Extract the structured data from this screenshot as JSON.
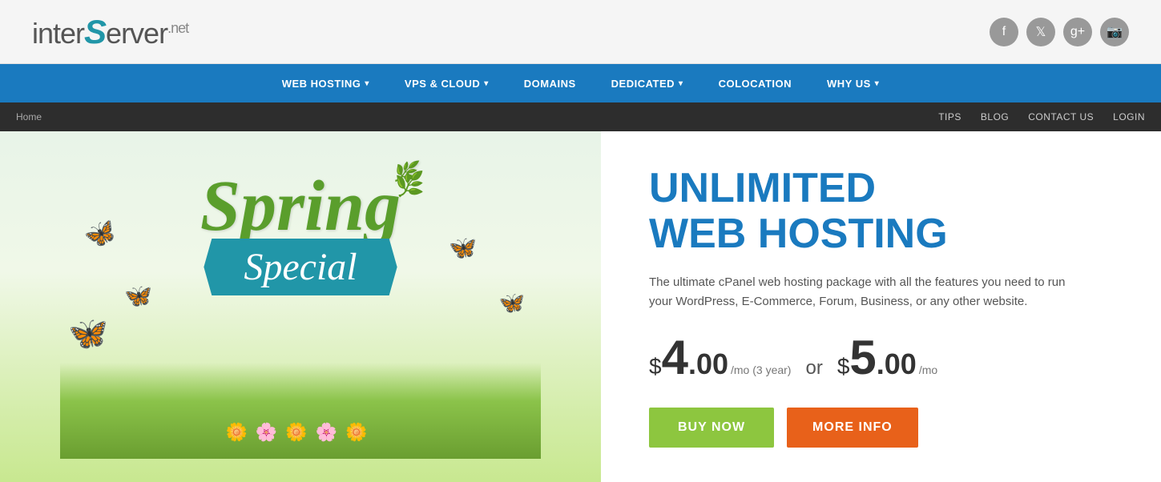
{
  "header": {
    "logo": {
      "part1": "inter",
      "curl": "S",
      "part2": "erver",
      "tld": ".net"
    },
    "social": [
      {
        "name": "facebook",
        "icon": "f"
      },
      {
        "name": "twitter",
        "icon": "t"
      },
      {
        "name": "google-plus",
        "icon": "g+"
      },
      {
        "name": "instagram",
        "icon": "in"
      }
    ]
  },
  "nav": {
    "items": [
      {
        "label": "WEB HOSTING",
        "has_dropdown": true
      },
      {
        "label": "VPS & CLOUD",
        "has_dropdown": true
      },
      {
        "label": "DOMAINS",
        "has_dropdown": false
      },
      {
        "label": "DEDICATED",
        "has_dropdown": true
      },
      {
        "label": "COLOCATION",
        "has_dropdown": false
      },
      {
        "label": "WHY US",
        "has_dropdown": true
      }
    ]
  },
  "secondary_nav": {
    "breadcrumb": "Home",
    "links": [
      {
        "label": "TIPS"
      },
      {
        "label": "BLOG"
      },
      {
        "label": "CONTACT US"
      },
      {
        "label": "LOGIN"
      }
    ]
  },
  "banner": {
    "spring_text": "Spring",
    "special_text": "Special",
    "leaf_emoji": "🌿",
    "butterflies": [
      "🦋",
      "🦋",
      "🦋",
      "🦋",
      "🦋"
    ]
  },
  "offer": {
    "headline_line1": "UNLIMITED",
    "headline_line2": "WEB HOSTING",
    "description": "The ultimate cPanel web hosting package with all the features you need to run your WordPress, E-Commerce, Forum, Business, or any other website.",
    "price1": {
      "dollar": "$",
      "amount": "4",
      "cents": ".00",
      "suffix": "/mo (3 year)"
    },
    "price_or": "or",
    "price2": {
      "dollar": "$",
      "amount": "5",
      "cents": ".00",
      "suffix": "/mo"
    },
    "btn_buy": "BUY NOW",
    "btn_info": "MORE INFO"
  },
  "colors": {
    "nav_bg": "#1a7abf",
    "secondary_nav_bg": "#2d2d2d",
    "btn_buy": "#8dc63f",
    "btn_info": "#e8611a",
    "headline": "#1a7abf",
    "spring_green": "#6ab04c",
    "special_blue": "#1a7abf"
  }
}
